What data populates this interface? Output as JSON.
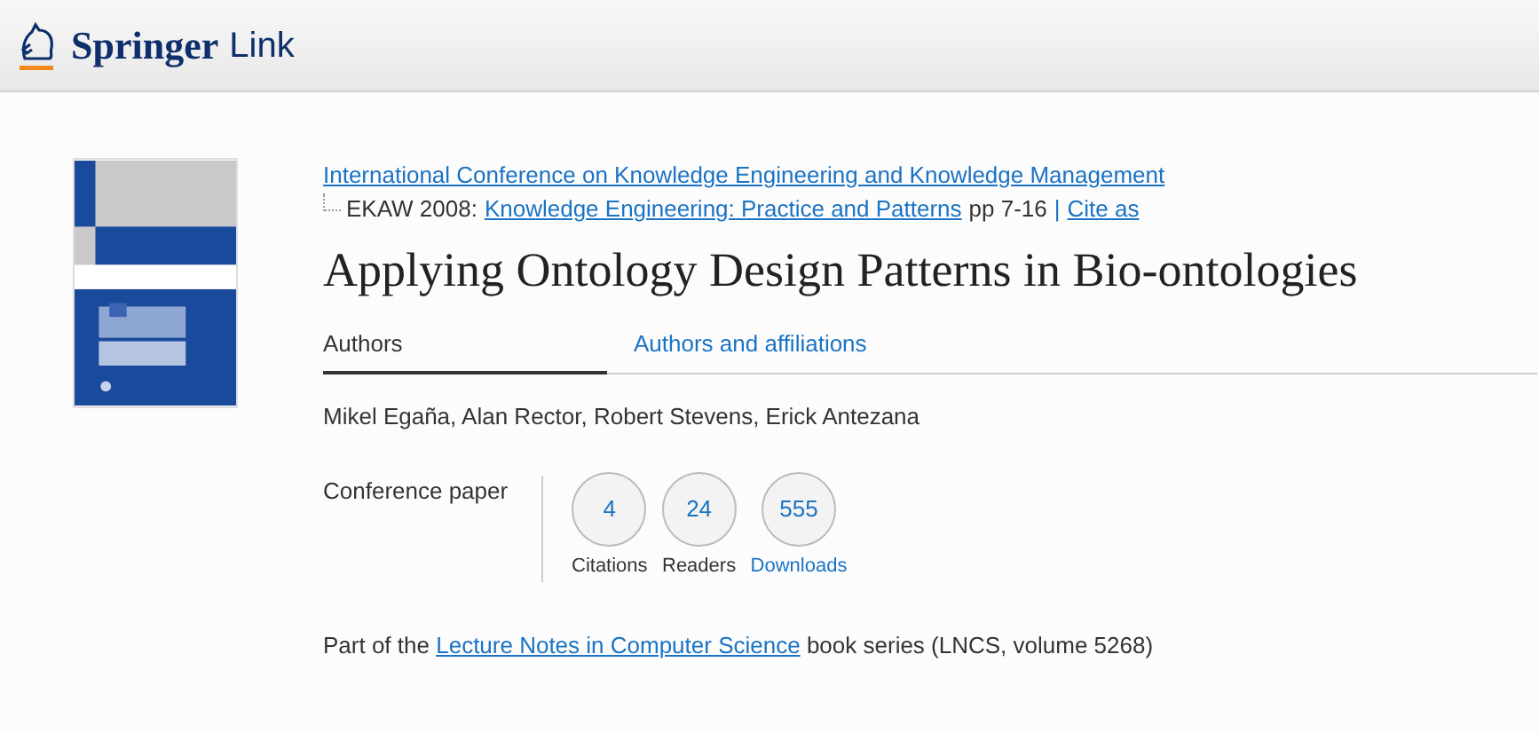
{
  "header": {
    "logo": {
      "brand": "Springer",
      "product": "Link"
    }
  },
  "breadcrumb": {
    "conference": "International Conference on Knowledge Engineering and Knowledge Management",
    "event": "EKAW 2008:",
    "proceedings": "Knowledge Engineering: Practice and Patterns",
    "pages": "pp 7-16",
    "separator": "|",
    "cite": "Cite as"
  },
  "title": "Applying Ontology Design Patterns in Bio-ontologies",
  "tabs": [
    {
      "label": "Authors",
      "selected": true
    },
    {
      "label": "Authors and affiliations",
      "selected": false
    }
  ],
  "authors": "Mikel Egaña, Alan Rector, Robert Stevens, Erick Antezana",
  "content_type": "Conference paper",
  "metrics": [
    {
      "value": "4",
      "label": "Citations",
      "kind": "plain"
    },
    {
      "value": "24",
      "label": "Readers",
      "kind": "plain"
    },
    {
      "value": "555",
      "label": "Downloads",
      "kind": "link"
    }
  ],
  "series": {
    "before": "Part of the",
    "link": "Lecture Notes in Computer Science",
    "after": "book series (LNCS, volume 5268)"
  }
}
